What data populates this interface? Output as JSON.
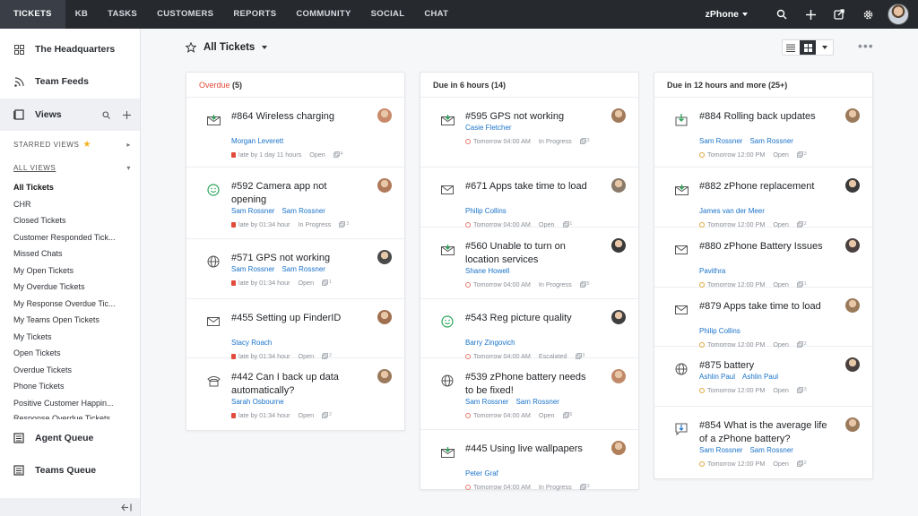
{
  "topnav": {
    "items": [
      "TICKETS",
      "KB",
      "TASKS",
      "CUSTOMERS",
      "REPORTS",
      "COMMUNITY",
      "SOCIAL",
      "CHAT"
    ],
    "brand": "zPhone"
  },
  "sidebar": {
    "headquarters": "The Headquarters",
    "team_feeds": "Team Feeds",
    "views": "Views",
    "starred_views": "STARRED VIEWS",
    "all_views": "ALL VIEWS",
    "view_items": [
      "All Tickets",
      "CHR",
      "Closed Tickets",
      "Customer Responded Tick...",
      "Missed Chats",
      "My Open Tickets",
      "My Overdue Tickets",
      "My Response Overdue Tic...",
      "My Teams Open Tickets",
      "My Tickets",
      "Open Tickets",
      "Overdue Tickets",
      "Phone Tickets",
      "Positive Customer Happin...",
      "Response Overdue Tickets"
    ],
    "agent_queue": "Agent Queue",
    "teams_queue": "Teams Queue"
  },
  "header": {
    "title": "All Tickets"
  },
  "columns": [
    {
      "title": "Overdue",
      "count": "(5)",
      "cards": [
        {
          "icon": "email-icon",
          "title": "#864 Wireless charging",
          "agents": [
            "Morgan Leverett"
          ],
          "due": "late by 1 day 11 hours",
          "status": "Open",
          "threads": "4",
          "avatar": "#c98a6a"
        },
        {
          "icon": "smile-icon",
          "title": "#592 Camera app not opening",
          "agents": [
            "Sam Rossner",
            "Sam Rossner"
          ],
          "due": "late by 01:34 hour",
          "status": "In Progress",
          "threads": "3",
          "avatar": "#b07a5a"
        },
        {
          "icon": "globe-icon",
          "title": "#571 GPS not working",
          "agents": [
            "Sam Rossner",
            "Sam Rossner"
          ],
          "due": "late by 01:34 hour",
          "status": "Open",
          "threads": "1",
          "avatar": "#4a4a4a"
        },
        {
          "icon": "envelope-icon",
          "title": "#455 Setting up FinderID",
          "agents": [
            "Stacy Roach"
          ],
          "due": "late by 01:34 hour",
          "status": "Open",
          "threads": "2",
          "avatar": "#a07050"
        },
        {
          "icon": "phone-icon",
          "title": "#442 Can I back up data automatically?",
          "agents": [
            "Sarah Osbourne"
          ],
          "due": "late by 01:34 hour",
          "status": "Open",
          "threads": "2",
          "avatar": "#9a7a5a"
        }
      ]
    },
    {
      "title": "Due in 6 hours",
      "count": "(14)",
      "cards": [
        {
          "icon": "email-icon",
          "title": "#595 GPS not working",
          "agents": [
            "Casie Fletcher"
          ],
          "due": "Tomorrow 04:00 AM",
          "status": "In Progress",
          "threads": "3",
          "avatar": "#a07a5a"
        },
        {
          "icon": "envelope-icon",
          "title": "#671 Apps take time to load",
          "agents": [
            "Philip Collins"
          ],
          "due": "Tomorrow 04:00 AM",
          "status": "Open",
          "threads": "1",
          "avatar": "#8a7a6a"
        },
        {
          "icon": "email-icon",
          "title": "#560 Unable to turn on location services",
          "agents": [
            "Shane Howell"
          ],
          "due": "Tomorrow 04:00 AM",
          "status": "In Progress",
          "threads": "5",
          "avatar": "#3a3a3a"
        },
        {
          "icon": "smile-icon",
          "title": "#543 Reg picture quality",
          "agents": [
            "Barry Zingovich"
          ],
          "due": "Tomorrow 04:00 AM",
          "status": "Escalated",
          "threads": "3",
          "avatar": "#3f3f3f"
        },
        {
          "icon": "globe-icon",
          "title": "#539 zPhone battery needs to be fixed!",
          "agents": [
            "Sam Rossner",
            "Sam Rossner"
          ],
          "due": "Tomorrow 04:00 AM",
          "status": "Open",
          "threads": "6",
          "avatar": "#c08a6a"
        },
        {
          "icon": "email-icon",
          "title": "#445 Using live wallpapers",
          "agents": [
            "Peter Graf"
          ],
          "due": "Tomorrow 04:00 AM",
          "status": "In Progress",
          "threads": "3",
          "avatar": "#b0805a"
        }
      ]
    },
    {
      "title": "Due in 12 hours and more",
      "count": "(25+)",
      "cards": [
        {
          "icon": "import-icon",
          "title": "#884 Rolling back updates",
          "agents": [
            "Sam Rossner",
            "Sam Rossner"
          ],
          "due": "Tomorrow 12:00 PM",
          "status": "Open",
          "threads": "3",
          "avatar": "#9a7a5a"
        },
        {
          "icon": "email-icon",
          "title": "#882 zPhone replacement",
          "agents": [
            "James van der Meer"
          ],
          "due": "Tomorrow 12:00 PM",
          "status": "Open",
          "threads": "2",
          "avatar": "#3a3a3a"
        },
        {
          "icon": "envelope-icon",
          "title": "#880 zPhone Battery Issues",
          "agents": [
            "Pavithra"
          ],
          "due": "Tomorrow 12:00 PM",
          "status": "Open",
          "threads": "1",
          "avatar": "#4a4040"
        },
        {
          "icon": "envelope-icon",
          "title": "#879 Apps take time to load",
          "agents": [
            "Philip Collins"
          ],
          "due": "Tomorrow 12:00 PM",
          "status": "Open",
          "threads": "2",
          "avatar": "#9a7a5a"
        },
        {
          "icon": "globe-icon",
          "title": "#875 battery",
          "agents": [
            "Ashlin Paul",
            "Ashlin Paul"
          ],
          "due": "Tomorrow 12:00 PM",
          "status": "Open",
          "threads": "3",
          "avatar": "#4a4040"
        },
        {
          "icon": "chat-icon",
          "title": "#854 What is the average life of a zPhone battery?",
          "agents": [
            "Sam Rossner",
            "Sam Rossner"
          ],
          "due": "Tomorrow 12:00 PM",
          "status": "Open",
          "threads": "2",
          "avatar": "#9a7a5a"
        }
      ]
    }
  ]
}
